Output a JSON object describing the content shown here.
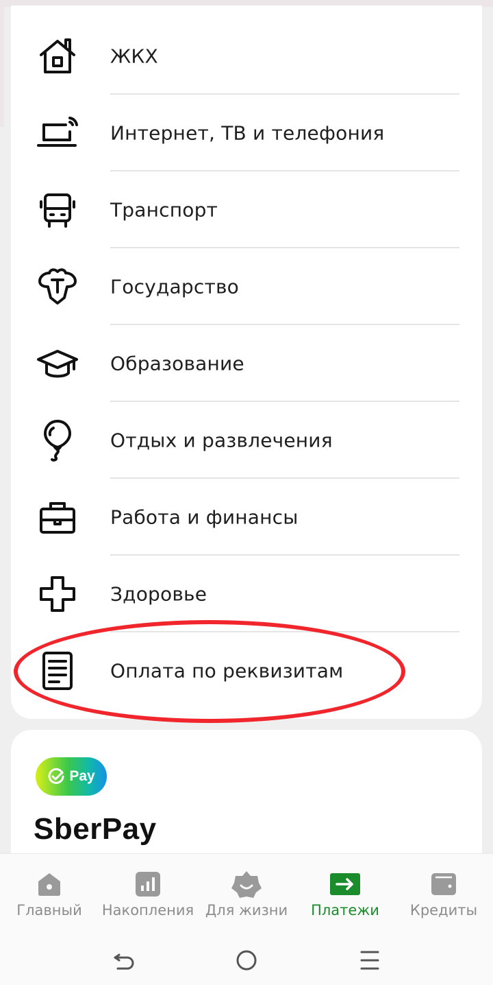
{
  "categories": [
    {
      "label": "ЖКХ",
      "icon": "house-icon"
    },
    {
      "label": "Интернет, ТВ и телефония",
      "icon": "laptop-wifi-icon"
    },
    {
      "label": "Транспорт",
      "icon": "bus-icon"
    },
    {
      "label": "Государство",
      "icon": "coat-of-arms-icon"
    },
    {
      "label": "Образование",
      "icon": "graduation-cap-icon"
    },
    {
      "label": "Отдых и развлечения",
      "icon": "balloon-icon"
    },
    {
      "label": "Работа и финансы",
      "icon": "briefcase-icon"
    },
    {
      "label": "Здоровье",
      "icon": "medical-cross-icon"
    },
    {
      "label": "Оплата по реквизитам",
      "icon": "document-icon",
      "highlighted": true
    }
  ],
  "sberpay": {
    "badge_label": "Pay",
    "title": "SberPay"
  },
  "bottom_nav": [
    {
      "label": "Главный",
      "icon": "home-icon",
      "active": false
    },
    {
      "label": "Накопления",
      "icon": "chart-icon",
      "active": false
    },
    {
      "label": "Для жизни",
      "icon": "smile-icon",
      "active": false
    },
    {
      "label": "Платежи",
      "icon": "payment-arrow-icon",
      "active": true
    },
    {
      "label": "Кредиты",
      "icon": "wallet-icon",
      "active": false
    }
  ],
  "colors": {
    "accent": "#1a8c2c",
    "highlight_circle": "#f0262c",
    "inactive": "#8c8c8c"
  }
}
